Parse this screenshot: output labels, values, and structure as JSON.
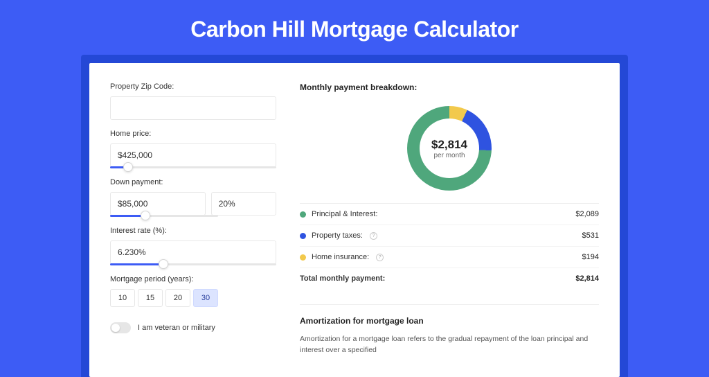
{
  "title": "Carbon Hill Mortgage Calculator",
  "form": {
    "zip_label": "Property Zip Code:",
    "zip_value": "",
    "price_label": "Home price:",
    "price_value": "$425,000",
    "down_label": "Down payment:",
    "down_value": "$85,000",
    "down_pct": "20%",
    "rate_label": "Interest rate (%):",
    "rate_value": "6.230%",
    "period_label": "Mortgage period (years):",
    "periods": [
      "10",
      "15",
      "20",
      "30"
    ],
    "period_selected": "30",
    "veteran_label": "I am veteran or military"
  },
  "breakdown": {
    "title": "Monthly payment breakdown:",
    "amount": "$2,814",
    "sub": "per month",
    "items": [
      {
        "label": "Principal & Interest:",
        "value": "$2,089",
        "color": "green"
      },
      {
        "label": "Property taxes:",
        "value": "$531",
        "color": "blue",
        "help": true
      },
      {
        "label": "Home insurance:",
        "value": "$194",
        "color": "yellow",
        "help": true
      }
    ],
    "total_label": "Total monthly payment:",
    "total_value": "$2,814"
  },
  "amort": {
    "title": "Amortization for mortgage loan",
    "text": "Amortization for a mortgage loan refers to the gradual repayment of the loan principal and interest over a specified"
  },
  "chart_data": {
    "type": "pie",
    "title": "Monthly payment breakdown",
    "series": [
      {
        "name": "Principal & Interest",
        "value": 2089,
        "color": "#4fa77c"
      },
      {
        "name": "Property taxes",
        "value": 531,
        "color": "#2f53e0"
      },
      {
        "name": "Home insurance",
        "value": 194,
        "color": "#f2c94c"
      }
    ],
    "total": 2814,
    "center_label": "$2,814 per month"
  }
}
